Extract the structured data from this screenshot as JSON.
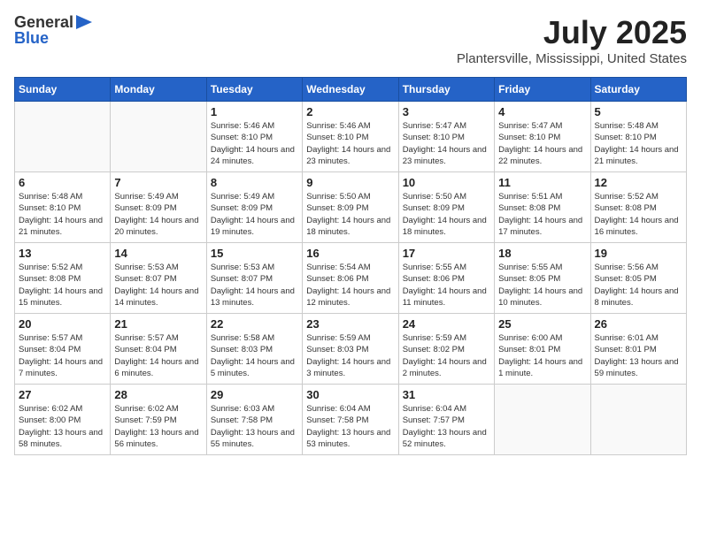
{
  "logo": {
    "general": "General",
    "blue": "Blue"
  },
  "title": "July 2025",
  "location": "Plantersville, Mississippi, United States",
  "weekdays": [
    "Sunday",
    "Monday",
    "Tuesday",
    "Wednesday",
    "Thursday",
    "Friday",
    "Saturday"
  ],
  "weeks": [
    [
      {
        "day": "",
        "sunrise": "",
        "sunset": "",
        "daylight": ""
      },
      {
        "day": "",
        "sunrise": "",
        "sunset": "",
        "daylight": ""
      },
      {
        "day": "1",
        "sunrise": "Sunrise: 5:46 AM",
        "sunset": "Sunset: 8:10 PM",
        "daylight": "Daylight: 14 hours and 24 minutes."
      },
      {
        "day": "2",
        "sunrise": "Sunrise: 5:46 AM",
        "sunset": "Sunset: 8:10 PM",
        "daylight": "Daylight: 14 hours and 23 minutes."
      },
      {
        "day": "3",
        "sunrise": "Sunrise: 5:47 AM",
        "sunset": "Sunset: 8:10 PM",
        "daylight": "Daylight: 14 hours and 23 minutes."
      },
      {
        "day": "4",
        "sunrise": "Sunrise: 5:47 AM",
        "sunset": "Sunset: 8:10 PM",
        "daylight": "Daylight: 14 hours and 22 minutes."
      },
      {
        "day": "5",
        "sunrise": "Sunrise: 5:48 AM",
        "sunset": "Sunset: 8:10 PM",
        "daylight": "Daylight: 14 hours and 21 minutes."
      }
    ],
    [
      {
        "day": "6",
        "sunrise": "Sunrise: 5:48 AM",
        "sunset": "Sunset: 8:10 PM",
        "daylight": "Daylight: 14 hours and 21 minutes."
      },
      {
        "day": "7",
        "sunrise": "Sunrise: 5:49 AM",
        "sunset": "Sunset: 8:09 PM",
        "daylight": "Daylight: 14 hours and 20 minutes."
      },
      {
        "day": "8",
        "sunrise": "Sunrise: 5:49 AM",
        "sunset": "Sunset: 8:09 PM",
        "daylight": "Daylight: 14 hours and 19 minutes."
      },
      {
        "day": "9",
        "sunrise": "Sunrise: 5:50 AM",
        "sunset": "Sunset: 8:09 PM",
        "daylight": "Daylight: 14 hours and 18 minutes."
      },
      {
        "day": "10",
        "sunrise": "Sunrise: 5:50 AM",
        "sunset": "Sunset: 8:09 PM",
        "daylight": "Daylight: 14 hours and 18 minutes."
      },
      {
        "day": "11",
        "sunrise": "Sunrise: 5:51 AM",
        "sunset": "Sunset: 8:08 PM",
        "daylight": "Daylight: 14 hours and 17 minutes."
      },
      {
        "day": "12",
        "sunrise": "Sunrise: 5:52 AM",
        "sunset": "Sunset: 8:08 PM",
        "daylight": "Daylight: 14 hours and 16 minutes."
      }
    ],
    [
      {
        "day": "13",
        "sunrise": "Sunrise: 5:52 AM",
        "sunset": "Sunset: 8:08 PM",
        "daylight": "Daylight: 14 hours and 15 minutes."
      },
      {
        "day": "14",
        "sunrise": "Sunrise: 5:53 AM",
        "sunset": "Sunset: 8:07 PM",
        "daylight": "Daylight: 14 hours and 14 minutes."
      },
      {
        "day": "15",
        "sunrise": "Sunrise: 5:53 AM",
        "sunset": "Sunset: 8:07 PM",
        "daylight": "Daylight: 14 hours and 13 minutes."
      },
      {
        "day": "16",
        "sunrise": "Sunrise: 5:54 AM",
        "sunset": "Sunset: 8:06 PM",
        "daylight": "Daylight: 14 hours and 12 minutes."
      },
      {
        "day": "17",
        "sunrise": "Sunrise: 5:55 AM",
        "sunset": "Sunset: 8:06 PM",
        "daylight": "Daylight: 14 hours and 11 minutes."
      },
      {
        "day": "18",
        "sunrise": "Sunrise: 5:55 AM",
        "sunset": "Sunset: 8:05 PM",
        "daylight": "Daylight: 14 hours and 10 minutes."
      },
      {
        "day": "19",
        "sunrise": "Sunrise: 5:56 AM",
        "sunset": "Sunset: 8:05 PM",
        "daylight": "Daylight: 14 hours and 8 minutes."
      }
    ],
    [
      {
        "day": "20",
        "sunrise": "Sunrise: 5:57 AM",
        "sunset": "Sunset: 8:04 PM",
        "daylight": "Daylight: 14 hours and 7 minutes."
      },
      {
        "day": "21",
        "sunrise": "Sunrise: 5:57 AM",
        "sunset": "Sunset: 8:04 PM",
        "daylight": "Daylight: 14 hours and 6 minutes."
      },
      {
        "day": "22",
        "sunrise": "Sunrise: 5:58 AM",
        "sunset": "Sunset: 8:03 PM",
        "daylight": "Daylight: 14 hours and 5 minutes."
      },
      {
        "day": "23",
        "sunrise": "Sunrise: 5:59 AM",
        "sunset": "Sunset: 8:03 PM",
        "daylight": "Daylight: 14 hours and 3 minutes."
      },
      {
        "day": "24",
        "sunrise": "Sunrise: 5:59 AM",
        "sunset": "Sunset: 8:02 PM",
        "daylight": "Daylight: 14 hours and 2 minutes."
      },
      {
        "day": "25",
        "sunrise": "Sunrise: 6:00 AM",
        "sunset": "Sunset: 8:01 PM",
        "daylight": "Daylight: 14 hours and 1 minute."
      },
      {
        "day": "26",
        "sunrise": "Sunrise: 6:01 AM",
        "sunset": "Sunset: 8:01 PM",
        "daylight": "Daylight: 13 hours and 59 minutes."
      }
    ],
    [
      {
        "day": "27",
        "sunrise": "Sunrise: 6:02 AM",
        "sunset": "Sunset: 8:00 PM",
        "daylight": "Daylight: 13 hours and 58 minutes."
      },
      {
        "day": "28",
        "sunrise": "Sunrise: 6:02 AM",
        "sunset": "Sunset: 7:59 PM",
        "daylight": "Daylight: 13 hours and 56 minutes."
      },
      {
        "day": "29",
        "sunrise": "Sunrise: 6:03 AM",
        "sunset": "Sunset: 7:58 PM",
        "daylight": "Daylight: 13 hours and 55 minutes."
      },
      {
        "day": "30",
        "sunrise": "Sunrise: 6:04 AM",
        "sunset": "Sunset: 7:58 PM",
        "daylight": "Daylight: 13 hours and 53 minutes."
      },
      {
        "day": "31",
        "sunrise": "Sunrise: 6:04 AM",
        "sunset": "Sunset: 7:57 PM",
        "daylight": "Daylight: 13 hours and 52 minutes."
      },
      {
        "day": "",
        "sunrise": "",
        "sunset": "",
        "daylight": ""
      },
      {
        "day": "",
        "sunrise": "",
        "sunset": "",
        "daylight": ""
      }
    ]
  ]
}
